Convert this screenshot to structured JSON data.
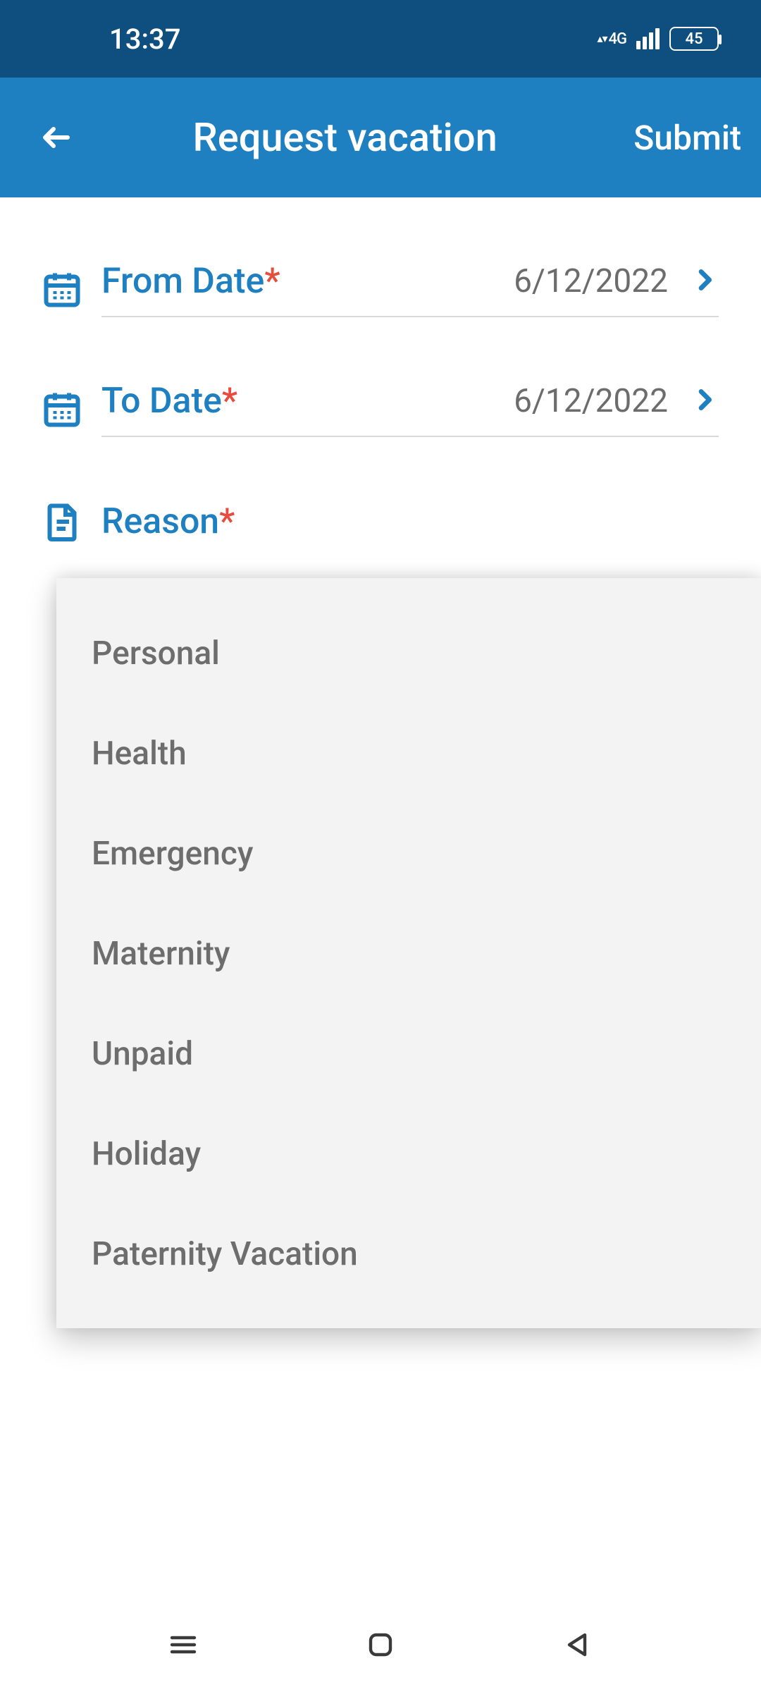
{
  "status": {
    "time": "13:37",
    "net_label": "4G",
    "battery": "45"
  },
  "header": {
    "title": "Request vacation",
    "submit": "Submit"
  },
  "fields": {
    "from": {
      "label": "From Date",
      "value": "6/12/2022"
    },
    "to": {
      "label": "To Date",
      "value": "6/12/2022"
    },
    "reason": {
      "label": "Reason"
    }
  },
  "reason_options": [
    "Personal",
    "Health",
    "Emergency",
    "Maternity",
    "Unpaid",
    "Holiday",
    "Paternity Vacation"
  ]
}
